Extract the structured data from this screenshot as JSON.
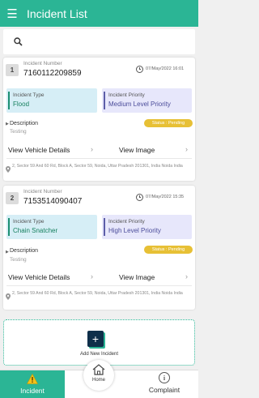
{
  "header": {
    "title": "Incident List",
    "menu_icon": "hamburger-icon"
  },
  "search": {
    "icon": "search-icon"
  },
  "incidents": [
    {
      "index": "1",
      "number_label": "Incident Number",
      "number": "7160112209859",
      "datetime": "07/May/2022 16:01",
      "type_label": "Incident Type",
      "type": "Flood",
      "priority_label": "Incident Priority",
      "priority": "Medium Level Priority",
      "description_label": "Description",
      "description": "Testing",
      "status": "Status : Pending",
      "view_vehicle": "View Vehicle Details",
      "view_image": "View Image",
      "address": "2, Sector 59 And 60 Rd, Block A, Sector 59, Noida, Uttar Pradesh 201301, India Noida India"
    },
    {
      "index": "2",
      "number_label": "Incident Number",
      "number": "7153514090407",
      "datetime": "07/May/2022 15:35",
      "type_label": "Incident Type",
      "type": "Chain Snatcher",
      "priority_label": "Incident Priority",
      "priority": "High Level Priority",
      "description_label": "Description",
      "description": "Testing",
      "status": "Status : Pending",
      "view_vehicle": "View Vehicle Details",
      "view_image": "View Image",
      "address": "2, Sector 59 And 60 Rd, Block A, Sector 59, Noida, Uttar Pradesh 201301, India Noida India"
    }
  ],
  "add_incident": {
    "label": "Add New Incident",
    "icon": "plus-icon"
  },
  "nav": {
    "incident": "Incident",
    "home": "Home",
    "complaint": "Complaint",
    "incident_icon": "warning-icon",
    "home_icon": "home-icon",
    "complaint_icon": "info-icon"
  },
  "colors": {
    "primary": "#2bb595",
    "type_box": "#d6eef6",
    "priority_box": "#e7e7fb",
    "status": "#e7c035",
    "add_icon_bg": "#0f2f4a"
  }
}
